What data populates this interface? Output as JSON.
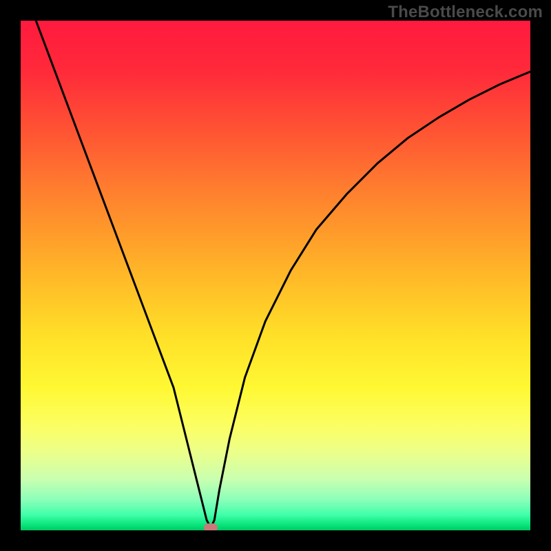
{
  "attribution": "TheBottleneck.com",
  "colors": {
    "frame": "#000000",
    "curve": "#000000",
    "marker": "#c97a78",
    "gradient_top": "#ff1a3e",
    "gradient_bottom": "#00c862"
  },
  "chart_data": {
    "type": "line",
    "title": "",
    "xlabel": "",
    "ylabel": "",
    "xlim": [
      0,
      100
    ],
    "ylim": [
      0,
      100
    ],
    "yflip": true,
    "grid": false,
    "legend": false,
    "series": [
      {
        "name": "bottleneck-curve",
        "x": [
          0,
          3,
          6,
          9,
          12,
          15,
          18,
          21,
          24,
          27,
          30,
          32,
          34,
          35.5,
          36.5,
          37.3,
          38,
          39,
          41,
          44,
          48,
          53,
          58,
          64,
          70,
          76,
          82,
          88,
          94,
          100
        ],
        "y": [
          108,
          100,
          92,
          84,
          76,
          68,
          60,
          52,
          44,
          36,
          28,
          20,
          12,
          6,
          2,
          0.5,
          2,
          8,
          18,
          30,
          41,
          51,
          59,
          66,
          72,
          77,
          81,
          84.5,
          87.5,
          90
        ]
      }
    ],
    "marker": {
      "x": 37.3,
      "y": 0.5
    },
    "background_gradient": [
      {
        "stop": 0.0,
        "color": "#ff1a3e"
      },
      {
        "stop": 0.1,
        "color": "#ff2a3a"
      },
      {
        "stop": 0.22,
        "color": "#ff5533"
      },
      {
        "stop": 0.32,
        "color": "#ff7a2f"
      },
      {
        "stop": 0.42,
        "color": "#ff9c2a"
      },
      {
        "stop": 0.52,
        "color": "#ffbf28"
      },
      {
        "stop": 0.62,
        "color": "#ffe028"
      },
      {
        "stop": 0.72,
        "color": "#fff833"
      },
      {
        "stop": 0.8,
        "color": "#fbff66"
      },
      {
        "stop": 0.85,
        "color": "#eaff8c"
      },
      {
        "stop": 0.9,
        "color": "#c9ffb0"
      },
      {
        "stop": 0.94,
        "color": "#8cffba"
      },
      {
        "stop": 0.97,
        "color": "#3fffa8"
      },
      {
        "stop": 0.99,
        "color": "#07e37a"
      },
      {
        "stop": 1.0,
        "color": "#00c862"
      }
    ]
  }
}
